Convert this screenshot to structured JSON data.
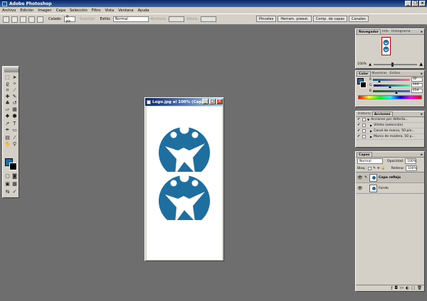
{
  "app": {
    "title": "Adobe Photoshop"
  },
  "menu": [
    "Archivo",
    "Edición",
    "Imagen",
    "Capa",
    "Selección",
    "Filtro",
    "Vista",
    "Ventana",
    "Ayuda"
  ],
  "options": {
    "feather_label": "Calado:",
    "feather_value": "0 px",
    "antialias_label": "Suavizar",
    "style_label": "Estilo:",
    "style_value": "Normal",
    "width_label": "Anchura:",
    "height_label": "Altura:"
  },
  "palette_well": [
    "Pinceles",
    "Herram. preest.",
    "Comp. de capas",
    "Canales"
  ],
  "document": {
    "title": "Logo.jpg al 100% (Capa..."
  },
  "navigator": {
    "tabs": [
      "Navegador",
      "Info",
      "Histograma"
    ],
    "zoom": "100%"
  },
  "color_panel": {
    "tabs": [
      "Color",
      "Muestras",
      "Estilos"
    ],
    "channels": [
      {
        "label": "R",
        "value": "32",
        "gradient": "linear-gradient(90deg,#006b9a,#ff6b9a)",
        "position": 0.13
      },
      {
        "label": "G",
        "value": "104",
        "gradient": "linear-gradient(90deg,#20009a,#20ff9a)",
        "position": 0.41
      },
      {
        "label": "B",
        "value": "154",
        "gradient": "linear-gradient(90deg,#206b00,#206bff)",
        "position": 0.6
      }
    ],
    "fg_color": "#20689a"
  },
  "actions_panel": {
    "tabs": [
      "Historia",
      "Acciones"
    ],
    "items": [
      "Acciones por defecto...",
      "Viñeta (selección)",
      "Canal de marco, 50 píx...",
      "Marco de madera, 50 p..."
    ]
  },
  "layers_panel": {
    "tab": "Capas",
    "blend_mode": "Normal",
    "opacity_label": "Opacidad:",
    "opacity_value": "100%",
    "lock_label": "Bloq.:",
    "fill_label": "Relleno:",
    "fill_value": "100%",
    "layers": [
      {
        "name": "Capa reflejo",
        "selected": true
      },
      {
        "name": "Fondo",
        "selected": false
      }
    ]
  },
  "brand_color": "#1e6fa0"
}
